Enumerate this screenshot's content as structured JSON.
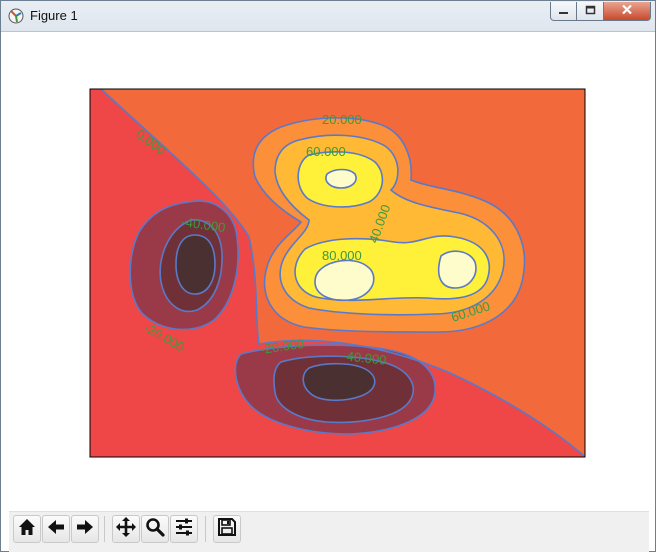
{
  "window": {
    "title": "Figure 1",
    "icon": "matplotlib-logo-icon",
    "controls": [
      "minimize-icon",
      "maximize-icon",
      "close-icon"
    ]
  },
  "toolbar": {
    "buttons": [
      "home-icon",
      "back-arrow-icon",
      "forward-arrow-icon",
      "pan-icon",
      "zoom-icon",
      "configure-subplots-icon",
      "save-icon"
    ]
  },
  "chart_data": {
    "type": "contour",
    "title": "",
    "xlabel": "",
    "ylabel": "",
    "axes_visible": false,
    "filled": true,
    "colormap": "hot (alpha 0.75)",
    "contour_lines": {
      "color": "#4a6fd6",
      "labels_color": "#3a9a3a"
    },
    "levels": [
      -60,
      -40,
      -20,
      0,
      20,
      40,
      60,
      80
    ],
    "level_labels": [
      "0.000",
      "20.000",
      "60.000",
      "40.000",
      "80.000",
      "60.000",
      "-40.000",
      "-20.000",
      "-20.000",
      "-40.000"
    ],
    "features": [
      {
        "kind": "peak",
        "max_level": 80,
        "location": "center"
      },
      {
        "kind": "peak",
        "max_level": 80,
        "location": "center-right"
      },
      {
        "kind": "peak",
        "max_level": 60,
        "location": "upper-center"
      },
      {
        "kind": "trough",
        "min_level": -60,
        "location": "left"
      },
      {
        "kind": "trough",
        "min_level": -60,
        "location": "lower-center"
      }
    ]
  }
}
